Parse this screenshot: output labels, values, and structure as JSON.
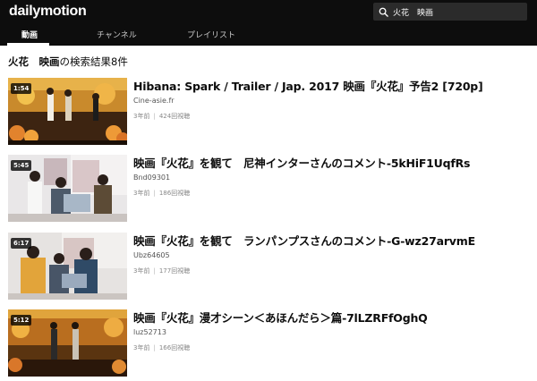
{
  "header": {
    "logo": "dailymotion",
    "search": {
      "value": "火花　映画"
    },
    "tabs": [
      {
        "label": "動画",
        "active": true
      },
      {
        "label": "チャンネル",
        "active": false
      },
      {
        "label": "プレイリスト",
        "active": false
      }
    ]
  },
  "results": {
    "query": "火花　映画",
    "summary": "の検索結果8件",
    "items": [
      {
        "duration": "1:54",
        "title": "Hibana: Spark / Trailer / Jap. 2017 映画『火花』予告2 [720p]",
        "channel": "Cine-asie.fr",
        "age": "3年前",
        "views": "424回視聴"
      },
      {
        "duration": "5:45",
        "title": "映画『火花』を観て　尼神インターさんのコメント-5kHiF1UqfRs",
        "channel": "Bnd09301",
        "age": "3年前",
        "views": "186回視聴"
      },
      {
        "duration": "6:17",
        "title": "映画『火花』を観て　ランパンプスさんのコメント-G-wz27arvmE",
        "channel": "Ubz64605",
        "age": "3年前",
        "views": "177回視聴"
      },
      {
        "duration": "5:12",
        "title": "映画『火花』漫才シーン＜あほんだら＞篇-7lLZRFfOghQ",
        "channel": "luz52713",
        "age": "3年前",
        "views": "166回視聴"
      }
    ]
  },
  "colors": {
    "header_bg": "#0d0d0d",
    "search_bg": "#2b2b2b",
    "text": "#0d0d0d",
    "muted": "#888888"
  },
  "icons": [
    "search-icon"
  ]
}
